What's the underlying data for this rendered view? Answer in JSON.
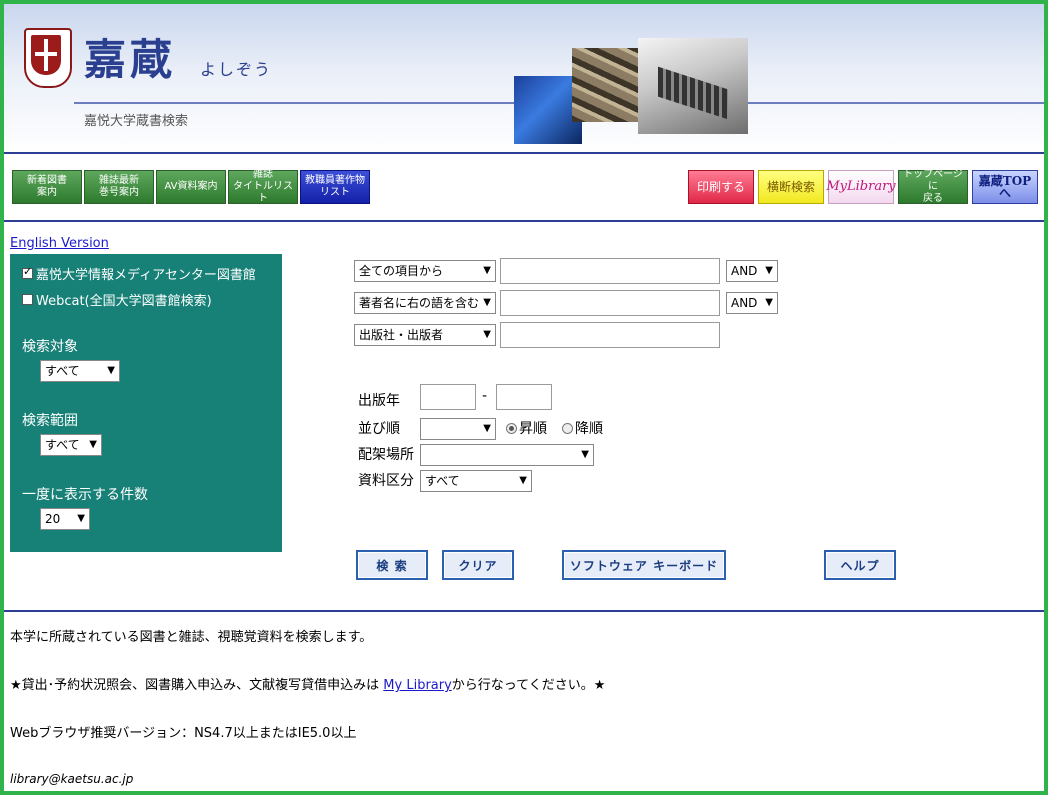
{
  "header": {
    "logo_kanji": "嘉蔵",
    "logo_kana": "よしぞう",
    "subtitle": "嘉悦大学蔵書検索"
  },
  "nav_left": [
    {
      "label": "新着図書\n案内",
      "color": "green"
    },
    {
      "label": "雑誌最新\n巻号案内",
      "color": "green"
    },
    {
      "label": "AV資料案内",
      "color": "green"
    },
    {
      "label": "雑誌\nタイトルリスト",
      "color": "green"
    },
    {
      "label": "教職員著作物\nリスト",
      "color": "blue"
    }
  ],
  "nav_right": [
    {
      "label": "印刷する",
      "color": "red"
    },
    {
      "label": "横断検索",
      "color": "yellow"
    },
    {
      "label": "MyLibrary",
      "color": "pink"
    },
    {
      "label": "トップページに\n戻る",
      "color": "green"
    },
    {
      "label": "嘉蔵TOPへ",
      "color": "navy"
    }
  ],
  "left_panel": {
    "english_link": "English Version",
    "targets": [
      {
        "label": "嘉悦大学情報メディアセンター図書館",
        "checked": true
      },
      {
        "label": "Webcat(全国大学図書館検索)",
        "checked": false
      }
    ],
    "search_target_label": "検索対象",
    "search_target_value": "すべて",
    "search_range_label": "検索範囲",
    "search_range_value": "すべて",
    "per_page_label": "一度に表示する件数",
    "per_page_value": "20"
  },
  "form": {
    "rows": [
      {
        "field": "全ての項目から",
        "value": "",
        "op": "AND"
      },
      {
        "field": "著者名に右の語を含む",
        "value": "",
        "op": "AND"
      },
      {
        "field": "出版社・出版者",
        "value": ""
      }
    ],
    "pub_year_label": "出版年",
    "pub_year_from": "",
    "pub_year_to": "",
    "dash": "-",
    "sort_label": "並び順",
    "sort_value": "",
    "asc_label": "昇順",
    "desc_label": "降順",
    "location_label": "配架場所",
    "location_value": "",
    "material_label": "資料区分",
    "material_value": "すべて"
  },
  "buttons": {
    "search": "検 索",
    "clear": "クリア",
    "keyboard": "ソフトウェア キーボード",
    "help": "ヘルプ"
  },
  "info": {
    "line1": "本学に所蔵されている図書と雑誌、視聴覚資料を検索します。",
    "line2_pre": "★貸出･予約状況照会、図書購入申込み、文献複写貸借申込みは",
    "line2_link": "My Library",
    "line2_post": "から行なってください。★",
    "line3": "Webブラウザ推奨バージョン：NS4.7以上またはIE5.0以上",
    "email": "library@kaetsu.ac.jp"
  },
  "colors": {
    "frame": "#2fb34a",
    "panel": "#178077",
    "rule": "#2e3e94"
  }
}
